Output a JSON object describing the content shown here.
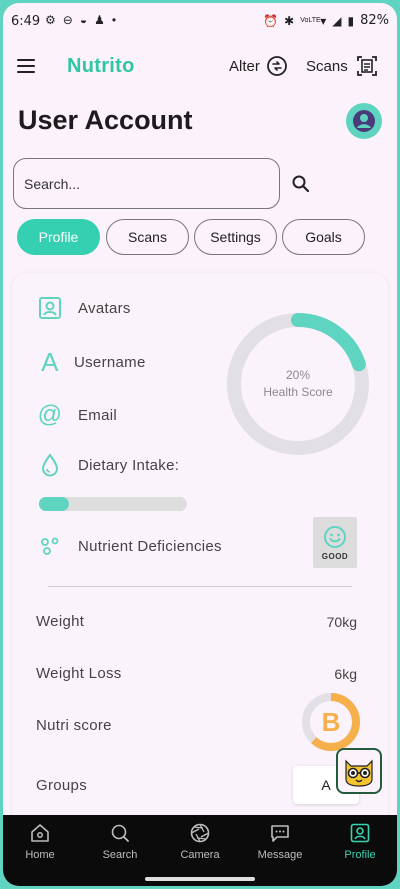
{
  "status_bar": {
    "time": "6:49",
    "battery": "82%",
    "network": "VoLTE"
  },
  "app": {
    "title": "Nutrito",
    "alter_label": "Alter",
    "scans_label": "Scans"
  },
  "page": {
    "title": "User Account"
  },
  "search": {
    "placeholder": "Search..."
  },
  "tabs": [
    {
      "label": "Profile",
      "active": true
    },
    {
      "label": "Scans",
      "active": false
    },
    {
      "label": "Settings",
      "active": false
    },
    {
      "label": "Goals",
      "active": false
    }
  ],
  "profile_items": [
    {
      "label": "Avatars",
      "icon": "avatar-frame-icon"
    },
    {
      "label": "Username",
      "icon": "letter-a-icon"
    },
    {
      "label": "Email",
      "icon": "at-sign-icon"
    },
    {
      "label": "Dietary Intake:",
      "icon": "water-drop-icon"
    },
    {
      "label": "Nutrient Deficiencies",
      "icon": "bubbles-icon"
    }
  ],
  "dietary_intake_progress": 0.2,
  "health_score": {
    "percent_label": "20%",
    "label": "Health Score",
    "value": 0.2
  },
  "mood_badge": {
    "label": "GOOD",
    "icon": "smiley-icon"
  },
  "stats": [
    {
      "label": "Weight",
      "value": "70kg"
    },
    {
      "label": "Weight Loss",
      "value": "6kg"
    },
    {
      "label": "Nutri score",
      "value": "B"
    },
    {
      "label": "Groups",
      "value": "A"
    }
  ],
  "nutri_score_value": 0.62,
  "bottom_nav": [
    {
      "label": "Home",
      "icon": "home-icon",
      "active": false
    },
    {
      "label": "Search",
      "icon": "search-icon",
      "active": false
    },
    {
      "label": "Camera",
      "icon": "camera-aperture-icon",
      "active": false
    },
    {
      "label": "Message",
      "icon": "message-icon",
      "active": false
    },
    {
      "label": "Profile",
      "icon": "profile-icon",
      "active": true
    }
  ],
  "colors": {
    "accent": "#35d0b1",
    "ring_track": "#e2e0e4",
    "nutri_orange": "#f5b04c",
    "nav_bg": "#0b0b0b"
  }
}
